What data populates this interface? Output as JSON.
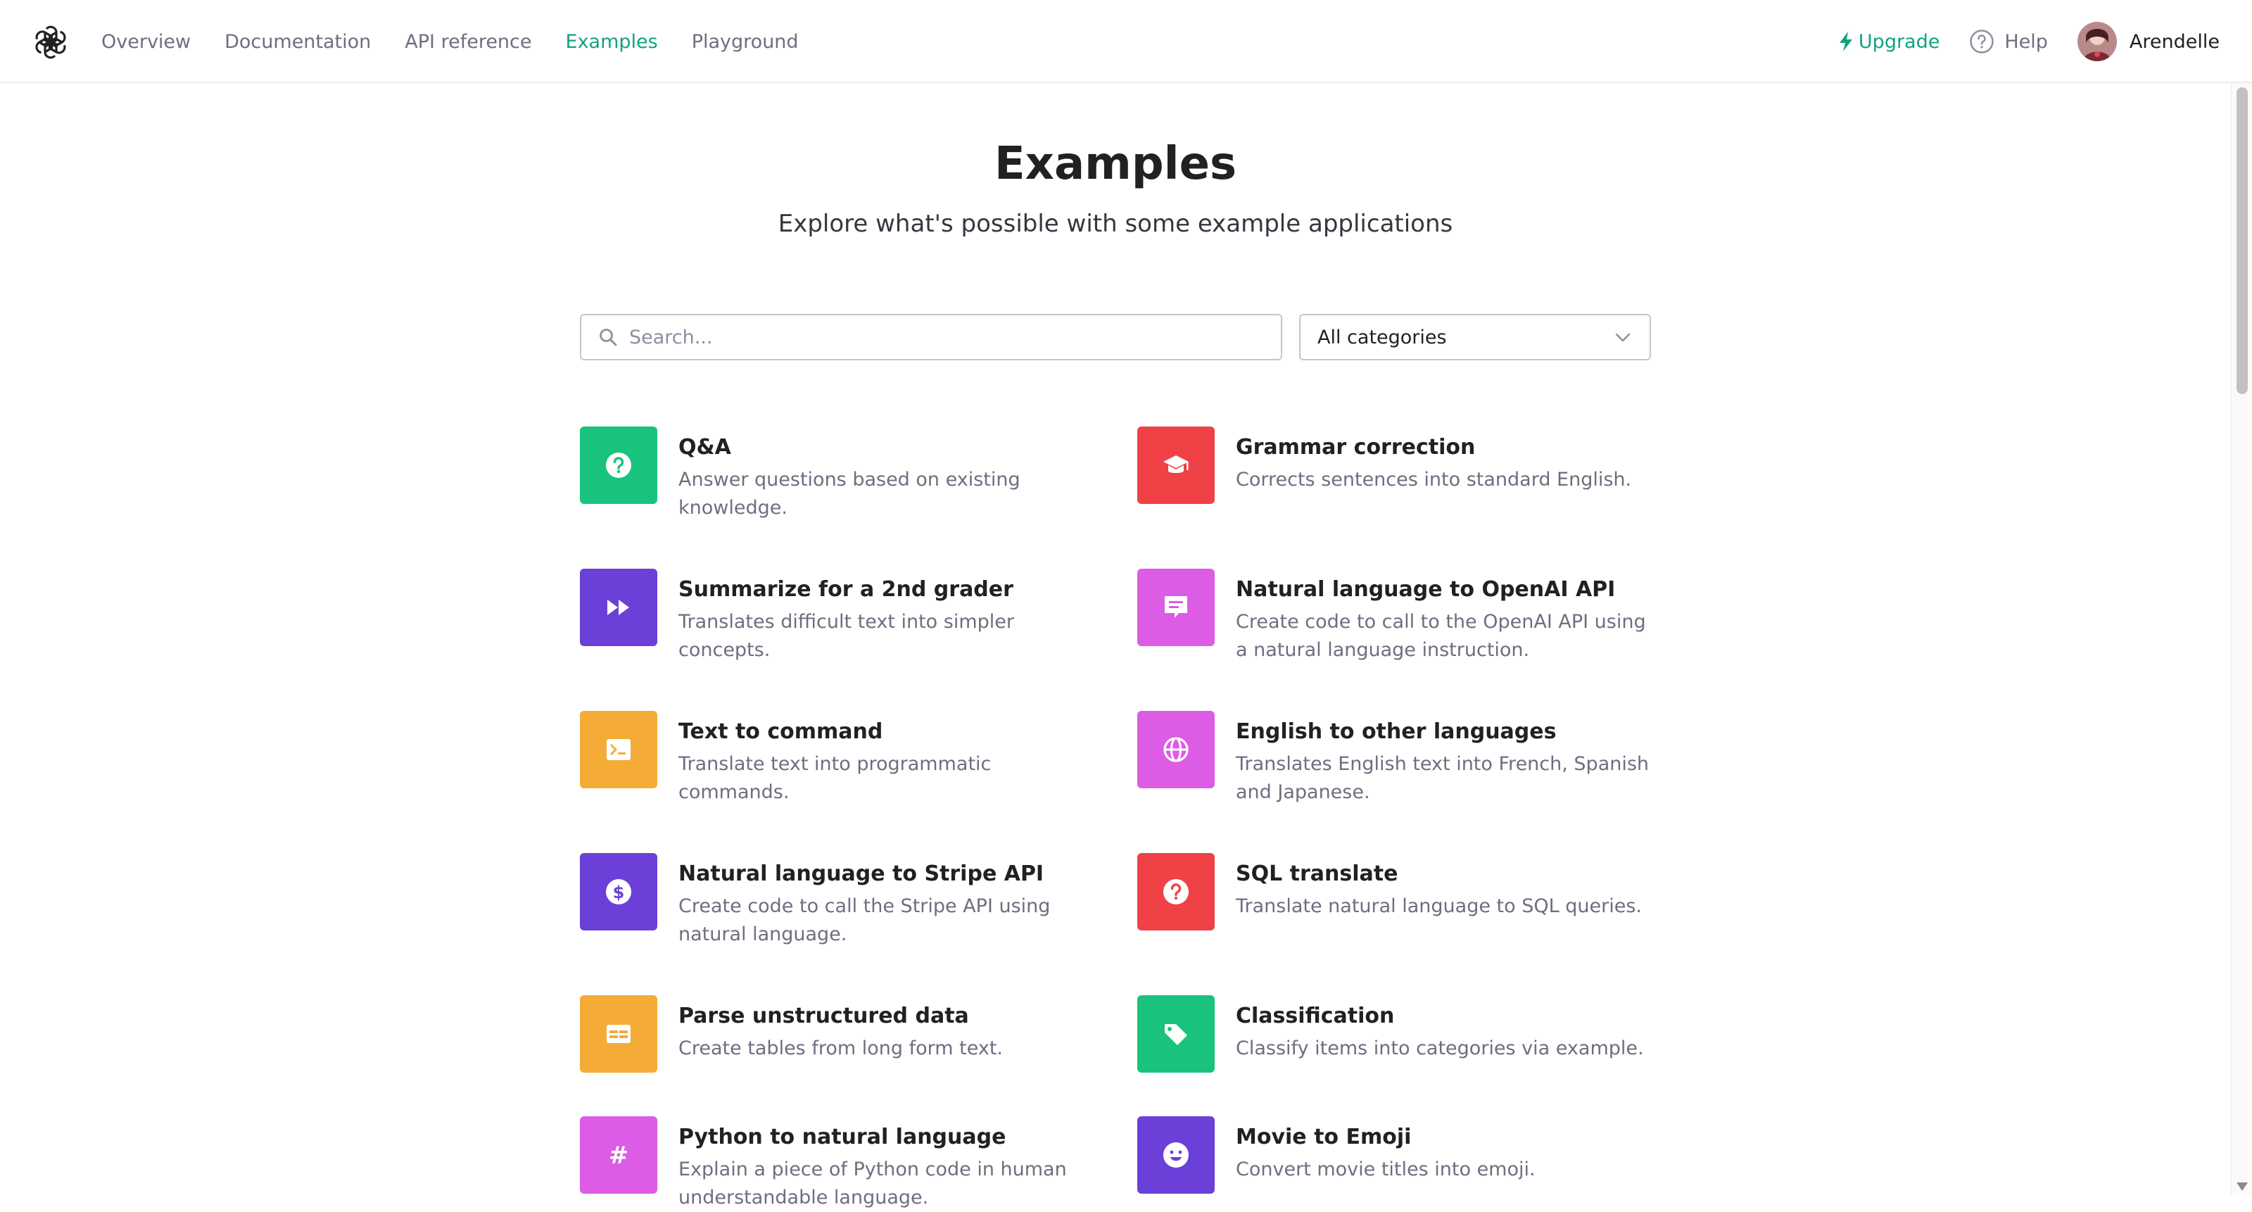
{
  "nav": {
    "links": [
      "Overview",
      "Documentation",
      "API reference",
      "Examples",
      "Playground"
    ],
    "active": "Examples",
    "upgrade": "Upgrade",
    "help": "Help",
    "user": "Arendelle"
  },
  "header": {
    "title": "Examples",
    "subtitle": "Explore what's possible with some example applications"
  },
  "search": {
    "placeholder": "Search...",
    "value": ""
  },
  "filter": {
    "selected": "All categories"
  },
  "colors": {
    "accent": "#10a37f",
    "green": "#19c37d",
    "red": "#ef4146",
    "purple": "#6b40d8",
    "magenta": "#dd5ce5",
    "orange": "#f4ac36"
  },
  "examples": [
    {
      "title": "Q&A",
      "desc": [
        "Answer questions based on existing",
        "knowledge."
      ],
      "color": "#19c37d",
      "icon": "question-icon"
    },
    {
      "title": "Grammar correction",
      "desc": [
        "Corrects sentences into standard English."
      ],
      "color": "#ef4146",
      "icon": "graduation-cap-icon"
    },
    {
      "title": "Summarize for a 2nd grader",
      "desc": [
        "Translates difficult text into simpler",
        "concepts."
      ],
      "color": "#6b40d8",
      "icon": "fast-forward-icon"
    },
    {
      "title": "Natural language to OpenAI API",
      "desc": [
        "Create code to call to the OpenAI API using",
        "a natural language instruction."
      ],
      "color": "#dd5ce5",
      "icon": "chat-bubble-icon"
    },
    {
      "title": "Text to command",
      "desc": [
        "Translate text into programmatic commands."
      ],
      "color": "#f4ac36",
      "icon": "terminal-icon"
    },
    {
      "title": "English to other languages",
      "desc": [
        "Translates English text into French, Spanish",
        "and Japanese."
      ],
      "color": "#dd5ce5",
      "icon": "globe-icon"
    },
    {
      "title": "Natural language to Stripe API",
      "desc": [
        "Create code to call the Stripe API using",
        "natural language."
      ],
      "color": "#6b40d8",
      "icon": "dollar-icon"
    },
    {
      "title": "SQL translate",
      "desc": [
        "Translate natural language to SQL queries."
      ],
      "color": "#ef4146",
      "icon": "question-icon"
    },
    {
      "title": "Parse unstructured data",
      "desc": [
        "Create tables from long form text."
      ],
      "color": "#f4ac36",
      "icon": "table-icon"
    },
    {
      "title": "Classification",
      "desc": [
        "Classify items into categories via example."
      ],
      "color": "#19c37d",
      "icon": "tag-icon"
    },
    {
      "title": "Python to natural language",
      "desc": [
        "Explain a piece of Python code in human",
        "understandable language."
      ],
      "color": "#dd5ce5",
      "icon": "hashtag-icon"
    },
    {
      "title": "Movie to Emoji",
      "desc": [
        "Convert movie titles into emoji."
      ],
      "color": "#6b40d8",
      "icon": "smiley-icon"
    }
  ]
}
